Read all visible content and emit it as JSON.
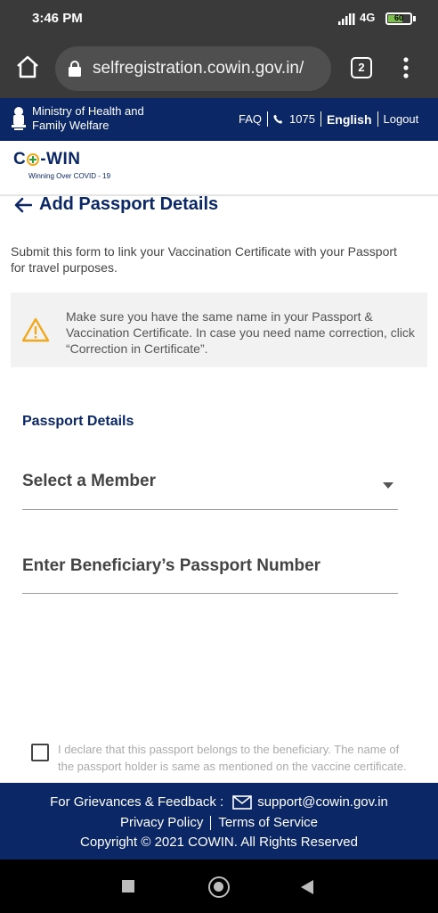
{
  "status_bar": {
    "time": "3:46 PM",
    "network": "4G",
    "battery": "60",
    "battery_level": 0.6
  },
  "browser": {
    "url": "selfregistration.cowin.gov.in/",
    "tab_count": "2"
  },
  "ministry_header": {
    "name": "Ministry of Health and Family Welfare",
    "faq": "FAQ",
    "helpline": "1075",
    "language": "English",
    "logout": "Logout"
  },
  "brand": {
    "name_left": "C",
    "name_right": "-WIN",
    "tagline": "Winning Over COVID - 19"
  },
  "page": {
    "title": "Add Passport Details",
    "intro": "Submit this form to link your Vaccination Certificate with your Passport for travel purposes.",
    "warning": "Make sure you have the same name in your Passport & Vaccination Certificate. In case you need name correction, click “Correction in Certificate”."
  },
  "form": {
    "section_heading": "Passport Details",
    "member_select_label": "Select a Member",
    "passport_placeholder": "Enter Beneficiary’s Passport Number",
    "declaration": "I declare that this passport belongs to the beneficiary. The name of the passport holder is same as mentioned on the vaccine certificate."
  },
  "footer": {
    "grievance_label": "For Grievances & Feedback :",
    "email": "support@cowin.gov.in",
    "privacy": "Privacy Policy",
    "terms": "Terms of Service",
    "copyright": "Copyright © 2021 COWIN. All Rights Reserved"
  },
  "colors": {
    "primary_navy": "#0b2765",
    "warning_amber": "#f2a81d",
    "battery_green": "#7cc04b"
  }
}
